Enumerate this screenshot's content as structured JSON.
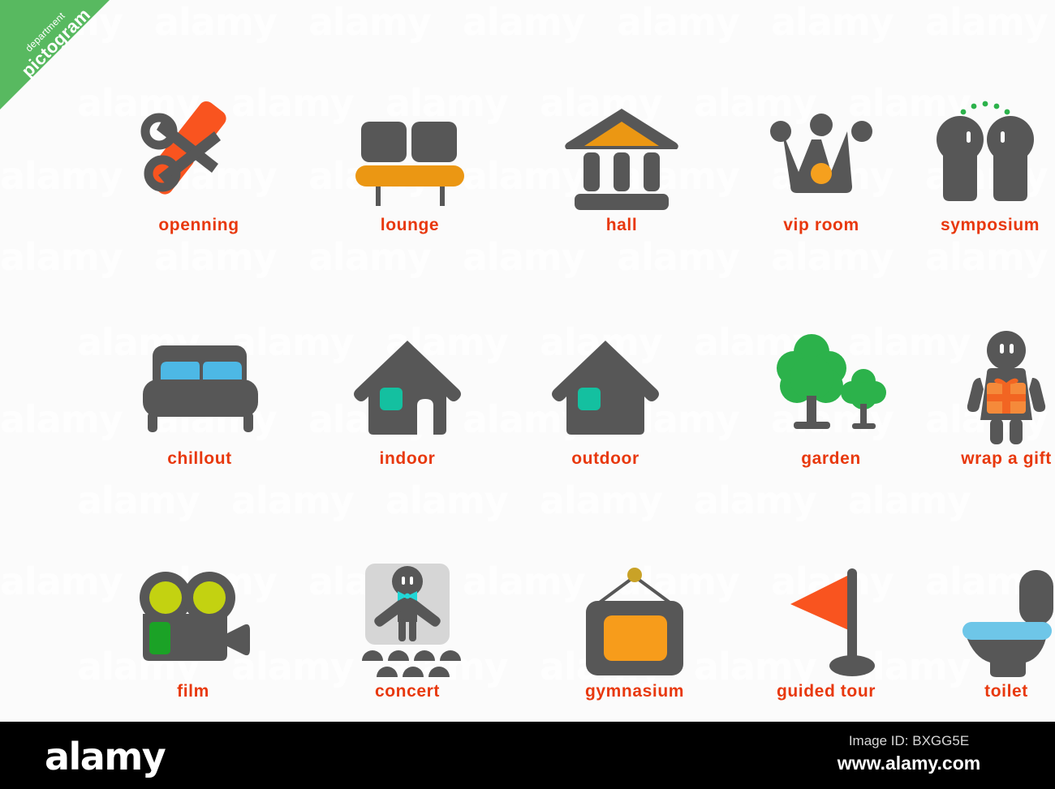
{
  "banner": {
    "line1": "department",
    "line2": "pictogram",
    "color": "#58b960"
  },
  "palette": {
    "gray": "#575757",
    "orange": "#f26522",
    "amber": "#eb9713",
    "label_red": "#e8380d",
    "teal": "#14c0a0",
    "blue": "#4db8e5",
    "green": "#2cb24b",
    "yellow_green": "#c3d211",
    "bright_green": "#1ba226",
    "light_gray": "#d6d6d6",
    "cyan": "#21d6d6",
    "gold": "#c9a227",
    "dot_green": "#2cb24b",
    "background": "#fbfbfb"
  },
  "grid": {
    "rows": [
      {
        "items": [
          {
            "label": "openning",
            "icon": "scissors-ribbon-icon"
          },
          {
            "label": "lounge",
            "icon": "bench-sofa-icon"
          },
          {
            "label": "hall",
            "icon": "classical-building-icon"
          },
          {
            "label": "vip room",
            "icon": "crown-icon"
          },
          {
            "label": "symposium",
            "icon": "two-people-talking-icon"
          }
        ]
      },
      {
        "items": [
          {
            "label": "chillout",
            "icon": "bed-icon"
          },
          {
            "label": "indoor",
            "icon": "house-with-door-icon"
          },
          {
            "label": "outdoor",
            "icon": "house-solid-icon"
          },
          {
            "label": "garden",
            "icon": "two-trees-icon"
          },
          {
            "label": "wrap a gift",
            "icon": "person-holding-gift-icon"
          }
        ]
      },
      {
        "items": [
          {
            "label": "film",
            "icon": "movie-camera-icon"
          },
          {
            "label": "concert",
            "icon": "performer-on-stage-icon"
          },
          {
            "label": "gymnasium",
            "icon": "hanging-scoreboard-icon"
          },
          {
            "label": "guided tour",
            "icon": "flag-pole-icon"
          },
          {
            "label": "toilet",
            "icon": "toilet-icon"
          }
        ]
      }
    ]
  },
  "watermark": {
    "text": "alamy"
  },
  "footer": {
    "logo": "alamy",
    "image_id": "Image ID: BXGG5E",
    "website": "www.alamy.com"
  }
}
